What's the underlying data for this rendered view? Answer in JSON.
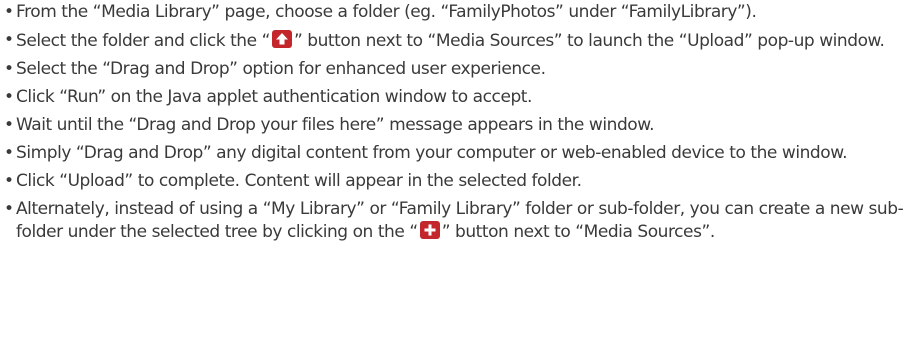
{
  "instructions": {
    "step1": "From the “Media Library” page, choose a folder (eg. “FamilyPhotos” under “FamilyLibrary”).",
    "step2_before": "Select the folder and click the “",
    "step2_after": "” button next to “Media Sources” to launch the “Upload” pop-up window.",
    "step3": "Select the “Drag and Drop” option for enhanced user experience.",
    "step4": "Click “Run” on the Java applet authentication window to accept.",
    "step5": "Wait until the “Drag and Drop your files here” message appears in the window.",
    "step6": "Simply “Drag and Drop” any digital content from your computer or web-enabled device to the window.",
    "step7": "Click “Upload” to complete. Content will appear in the selected folder.",
    "step8_before": "Alternately, instead of using a “My Library” or “Family Library” folder or sub-folder, you can create a new sub-folder under the selected tree by clicking on the “",
    "step8_after": "” button next to “Media Sources”."
  },
  "icons": {
    "upload": "upload-arrow-icon",
    "add": "plus-icon"
  },
  "colors": {
    "text": "#3a3a3a",
    "icon_background": "#c3272c",
    "icon_glyph": "#ffffff"
  }
}
